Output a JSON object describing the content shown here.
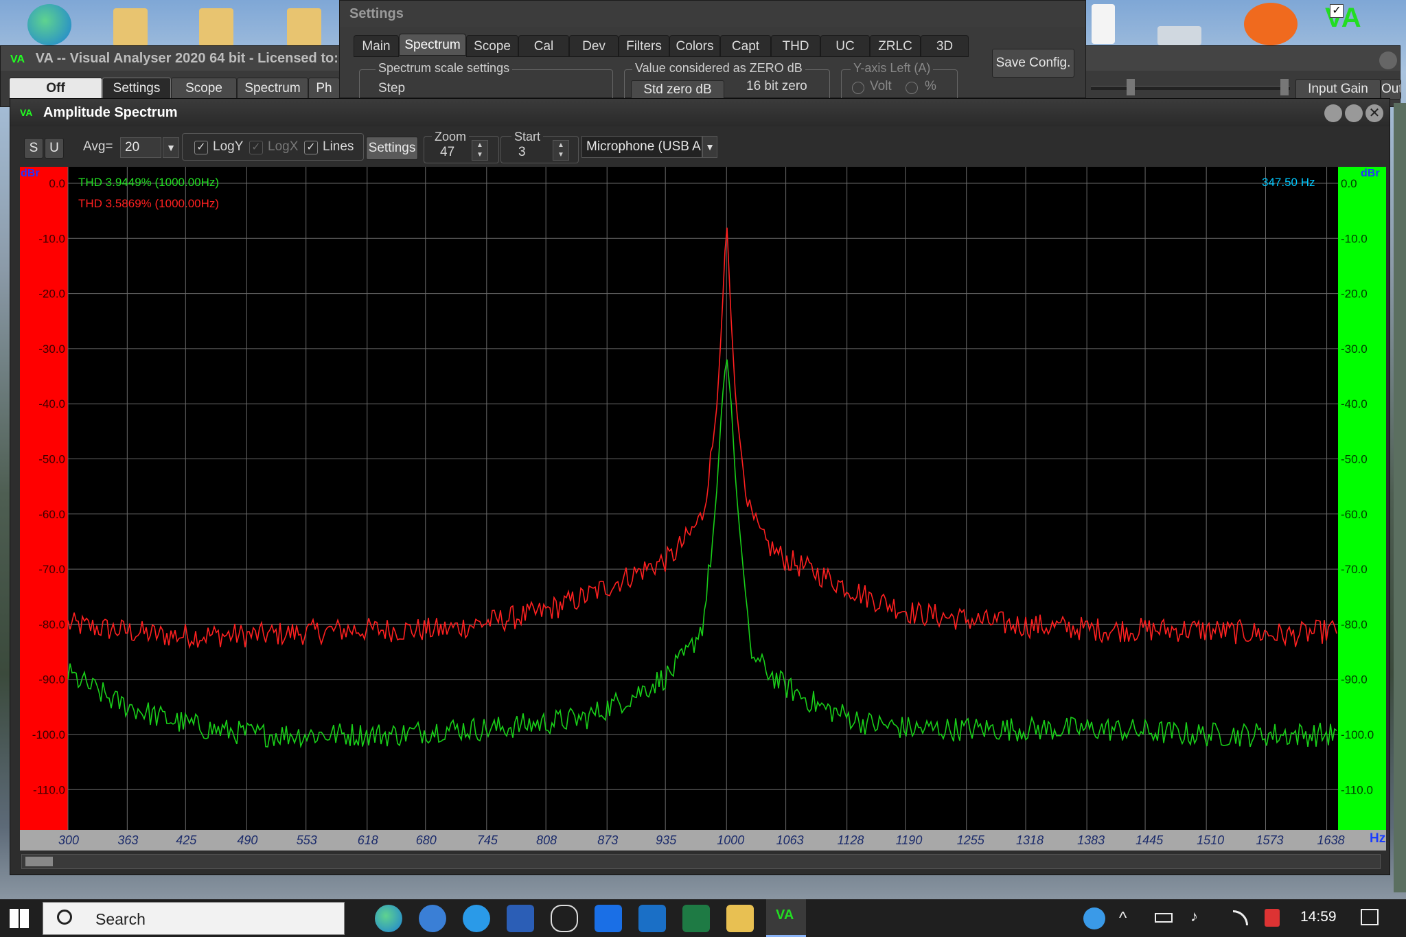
{
  "colors": {
    "accent_red": "#ff0000",
    "accent_green": "#00ff00",
    "trace_red": "#ff2020",
    "trace_green": "#19d019",
    "cyan": "#00c8ff"
  },
  "main_window": {
    "title": "VA -- Visual Analyser 2020 64 bit - Licensed to:",
    "buttons": [
      "Off",
      "Settings",
      "Scope",
      "Spectrum",
      "Ph"
    ]
  },
  "settings_window": {
    "title": "Settings",
    "tabs": [
      "Main",
      "Spectrum",
      "Scope",
      "Cal",
      "Dev",
      "Filters",
      "Colors",
      "Capt",
      "THD",
      "UC",
      "ZRLC",
      "3D"
    ],
    "active_tab": "Spectrum",
    "group_spectrum_scale": "Spectrum scale settings",
    "step_label": "Step",
    "group_zero": "Value considered as ZERO dB",
    "std_zero": "Std zero dB",
    "bit_zero": "16 bit zero",
    "group_yaxis": "Y-axis Left (A)",
    "volt": "Volt",
    "percent": "%",
    "save_config": "Save Config."
  },
  "right_panel": {
    "input_gain": "Input Gain",
    "output": "Outp"
  },
  "spectrum_window": {
    "title": "Amplitude Spectrum",
    "s_button": "S",
    "u_button": "U",
    "avg_label": "Avg=",
    "avg_value": "20",
    "logy": "LogY",
    "logx": "LogX",
    "lines": "Lines",
    "settings_button": "Settings",
    "zoom_label": "Zoom",
    "zoom_value": "47",
    "start_label": "Start",
    "start_value": "3",
    "device": "Microphone (USB A",
    "thd_green": "THD 3.9449% (1000.00Hz)",
    "thd_red": "THD 3.5869% (1000.00Hz)",
    "cursor_freq": "347.50 Hz",
    "unit_left": "dBr",
    "unit_right": "dBr",
    "unit_x": "Hz"
  },
  "chart_data": {
    "type": "line",
    "xlabel": "Hz",
    "ylabel": "dBr",
    "xlim": [
      300,
      1650
    ],
    "ylim": [
      -117,
      3
    ],
    "grid": true,
    "x_ticks": [
      300,
      363,
      425,
      490,
      553,
      618,
      680,
      745,
      808,
      873,
      935,
      1000,
      1063,
      1128,
      1190,
      1255,
      1318,
      1383,
      1445,
      1510,
      1573,
      1638
    ],
    "y_ticks": [
      "0.0",
      "-10.0",
      "-20.0",
      "-30.0",
      "-40.0",
      "-50.0",
      "-60.0",
      "-70.0",
      "-80.0",
      "-90.0",
      "-100.0",
      "-110.0"
    ],
    "series": [
      {
        "name": "THD 3.5869% (1000.00Hz)",
        "color": "#ff2020",
        "x": [
          300,
          400,
          500,
          600,
          700,
          800,
          850,
          900,
          940,
          960,
          975,
          985,
          990,
          995,
          1000,
          1005,
          1010,
          1015,
          1025,
          1040,
          1060,
          1100,
          1150,
          1200,
          1300,
          1400,
          1500,
          1600,
          1650
        ],
        "y": [
          -80,
          -82,
          -82,
          -81,
          -81,
          -78,
          -75,
          -71,
          -68,
          -64,
          -60,
          -48,
          -40,
          -25,
          -6,
          -25,
          -40,
          -48,
          -60,
          -65,
          -68,
          -71,
          -75,
          -78,
          -80,
          -81,
          -81,
          -82,
          -81
        ]
      },
      {
        "name": "THD 3.9449% (1000.00Hz)",
        "color": "#19d019",
        "x": [
          300,
          350,
          400,
          450,
          500,
          550,
          600,
          650,
          700,
          750,
          800,
          850,
          900,
          940,
          960,
          975,
          985,
          990,
          995,
          1000,
          1005,
          1010,
          1015,
          1025,
          1040,
          1060,
          1100,
          1150,
          1200,
          1300,
          1400,
          1500,
          1600,
          1650
        ],
        "y": [
          -89,
          -94,
          -97,
          -99,
          -100,
          -100,
          -100,
          -100,
          -99,
          -99,
          -98,
          -97,
          -93,
          -89,
          -85,
          -80,
          -65,
          -55,
          -40,
          -31,
          -40,
          -55,
          -65,
          -85,
          -88,
          -91,
          -95,
          -98,
          -99,
          -99,
          -99,
          -100,
          -100,
          -100
        ]
      }
    ]
  },
  "taskbar": {
    "search_placeholder": "Search",
    "time": "14:59",
    "va_label": "VA"
  }
}
